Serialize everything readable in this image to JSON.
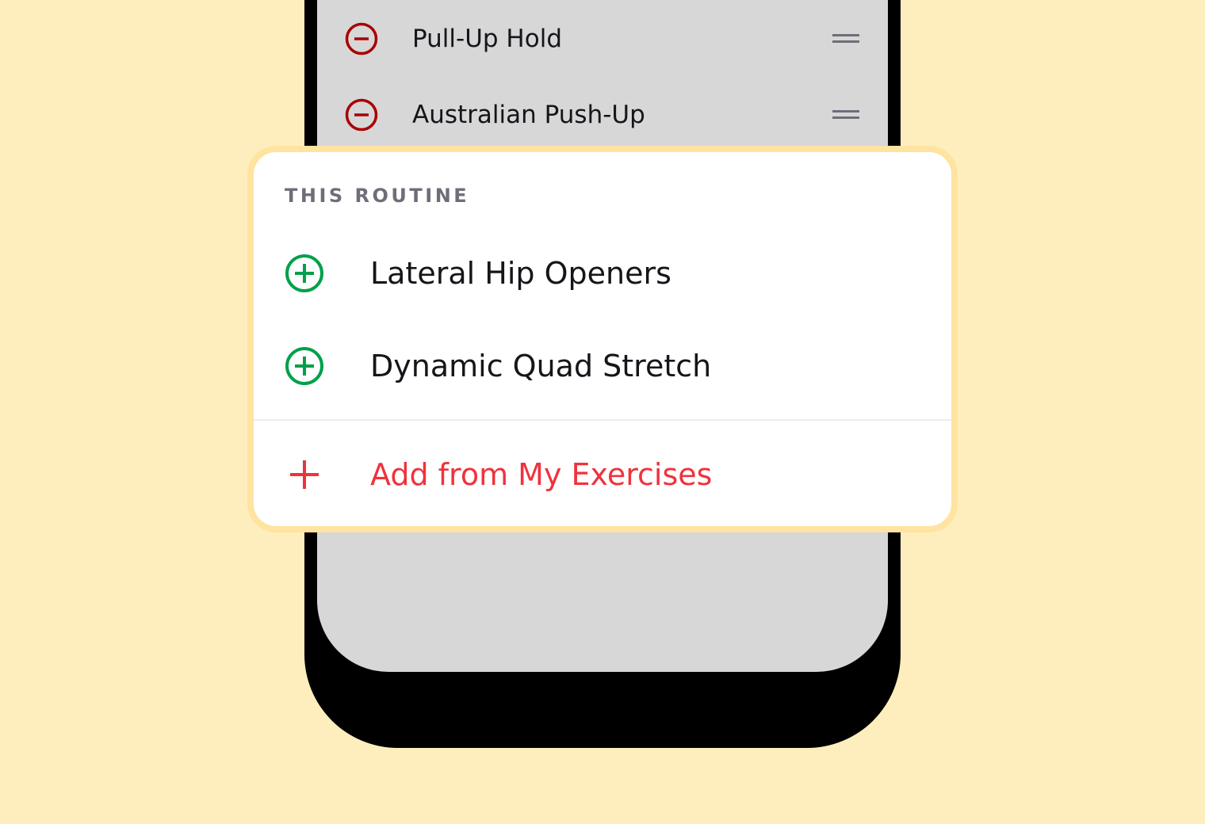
{
  "colors": {
    "page_background": "#FFEEBD",
    "remove_icon": "#A80000",
    "add_icon": "#00A04A",
    "accent_red": "#F0323C",
    "section_title": "#6E6E7A"
  },
  "routine_list": {
    "items": [
      {
        "label": "Pull-Up Hold",
        "leading_icon": "minus-circle-icon",
        "trailing_icon": "drag-handle-icon"
      },
      {
        "label": "Australian Push-Up",
        "leading_icon": "minus-circle-icon",
        "trailing_icon": "drag-handle-icon"
      }
    ]
  },
  "popover": {
    "section_title": "THIS ROUTINE",
    "items": [
      {
        "label": "Lateral Hip Openers",
        "icon": "plus-circle-icon"
      },
      {
        "label": "Dynamic Quad Stretch",
        "icon": "plus-circle-icon"
      }
    ],
    "action": {
      "label": "Add from My Exercises",
      "icon": "plus-icon"
    }
  }
}
